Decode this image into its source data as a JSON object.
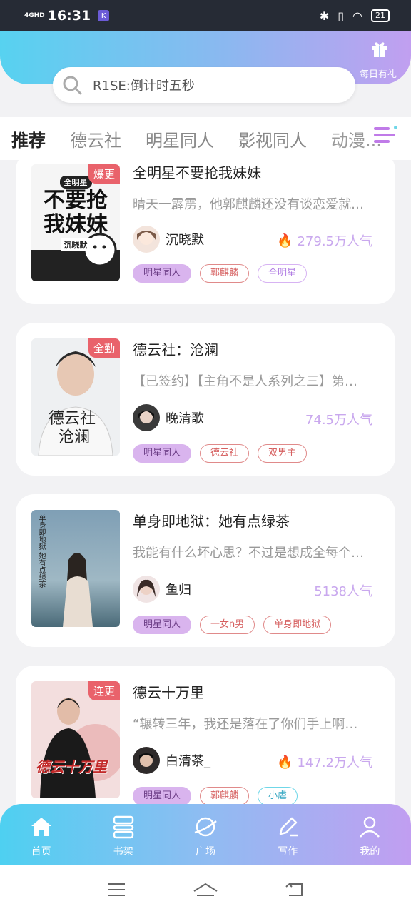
{
  "status_bar": {
    "network": "4GHD",
    "time": "16:31",
    "battery": "21"
  },
  "header": {
    "gift_label": "每日有礼",
    "gift_icon": "gift-icon"
  },
  "search": {
    "placeholder": "R1SE:倒计时五秒"
  },
  "tabs": [
    {
      "label": "推荐",
      "active": true
    },
    {
      "label": "德云社"
    },
    {
      "label": "明星同人"
    },
    {
      "label": "影视同人"
    },
    {
      "label": "动漫..."
    }
  ],
  "cards": [
    {
      "title": "全明星不要抢我妹妹",
      "desc": "晴天一霹雳，他郭麒麟还没有谈恋爱就…",
      "author": "沉晓默",
      "popularity": "279.5万人气",
      "show_flame": true,
      "badge": "爆更",
      "cover_text": [
        "全明星",
        "不要抢",
        "我妹妹",
        "沉晓默"
      ],
      "tags": [
        {
          "label": "明星同人",
          "style": "purple"
        },
        {
          "label": "郭麒麟",
          "style": "red"
        },
        {
          "label": "全明星",
          "style": "lilac"
        }
      ]
    },
    {
      "title": "德云社：沧澜",
      "desc": "【已签约】【主角不是人系列之三】第…",
      "author": "晚清歌",
      "popularity": "74.5万人气",
      "show_flame": false,
      "badge": "全勤",
      "cover_text": [
        "德云社",
        "沧澜"
      ],
      "tags": [
        {
          "label": "明星同人",
          "style": "purple"
        },
        {
          "label": "德云社",
          "style": "red"
        },
        {
          "label": "双男主",
          "style": "red"
        }
      ]
    },
    {
      "title": "单身即地狱：她有点绿茶",
      "desc": "我能有什么坏心思？不过是想成全每个…",
      "author": "鱼归",
      "popularity": "5138人气",
      "show_flame": false,
      "badge": "",
      "cover_text": [
        "单身即地狱",
        "她有点绿茶"
      ],
      "tags": [
        {
          "label": "明星同人",
          "style": "purple"
        },
        {
          "label": "一女n男",
          "style": "red"
        },
        {
          "label": "单身即地狱",
          "style": "red"
        }
      ]
    },
    {
      "title": "德云十万里",
      "desc": "“辗转三年，我还是落在了你们手上啊…",
      "author": "白清茶_",
      "popularity": "147.2万人气",
      "show_flame": true,
      "badge": "连更",
      "cover_text": [
        "德云十万里"
      ],
      "tags": [
        {
          "label": "明星同人",
          "style": "purple"
        },
        {
          "label": "郭麒麟",
          "style": "red"
        },
        {
          "label": "小虐",
          "style": "cyan"
        }
      ]
    }
  ],
  "bottom_nav": [
    {
      "label": "首页",
      "icon": "home-icon"
    },
    {
      "label": "书架",
      "icon": "bookshelf-icon"
    },
    {
      "label": "广场",
      "icon": "planet-icon"
    },
    {
      "label": "写作",
      "icon": "pen-icon"
    },
    {
      "label": "我的",
      "icon": "user-icon"
    }
  ],
  "colors": {
    "accent_purple": "#c19ef1",
    "accent_cyan": "#4ed0f1",
    "badge_red": "#e9626b"
  }
}
